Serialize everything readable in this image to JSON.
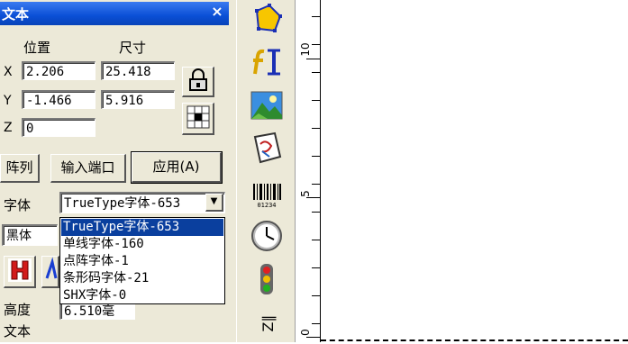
{
  "panel": {
    "title": "文本",
    "close_label": "×",
    "headers": {
      "position": "位置",
      "size": "尺寸"
    },
    "axes": {
      "x": "X",
      "y": "Y",
      "z": "Z"
    },
    "values": {
      "x_pos": "2.206",
      "y_pos": "-1.466",
      "z_pos": "0",
      "width": "25.418",
      "height": "5.916"
    },
    "buttons": {
      "array": "阵列",
      "input_port": "输入端口",
      "apply": "应用(A)"
    },
    "font_label": "字体",
    "font_type_selected": "TrueType字体-653",
    "font_name": "黑体",
    "height_label": "高度",
    "height_value": "6.510毫",
    "text_label": "文本"
  },
  "font_dropdown": {
    "options": [
      "TrueType字体-653",
      "单线字体-160",
      "点阵字体-1",
      "条形码字体-21",
      "SHX字体-0"
    ],
    "selected_index": 0
  },
  "toolbar": {
    "icons": [
      "polygon-icon",
      "text-icon",
      "image-icon",
      "vector-file-icon",
      "barcode-icon",
      "clock-icon",
      "traffic-light-icon",
      "extension-axis-icon"
    ],
    "barcode_digits": "01234"
  },
  "ruler": {
    "labels": [
      "10",
      "5",
      "0"
    ]
  },
  "colors": {
    "title_bar": "#0a4fd6",
    "selection": "#0a3f9e",
    "panel_bg": "#ece9d8"
  }
}
